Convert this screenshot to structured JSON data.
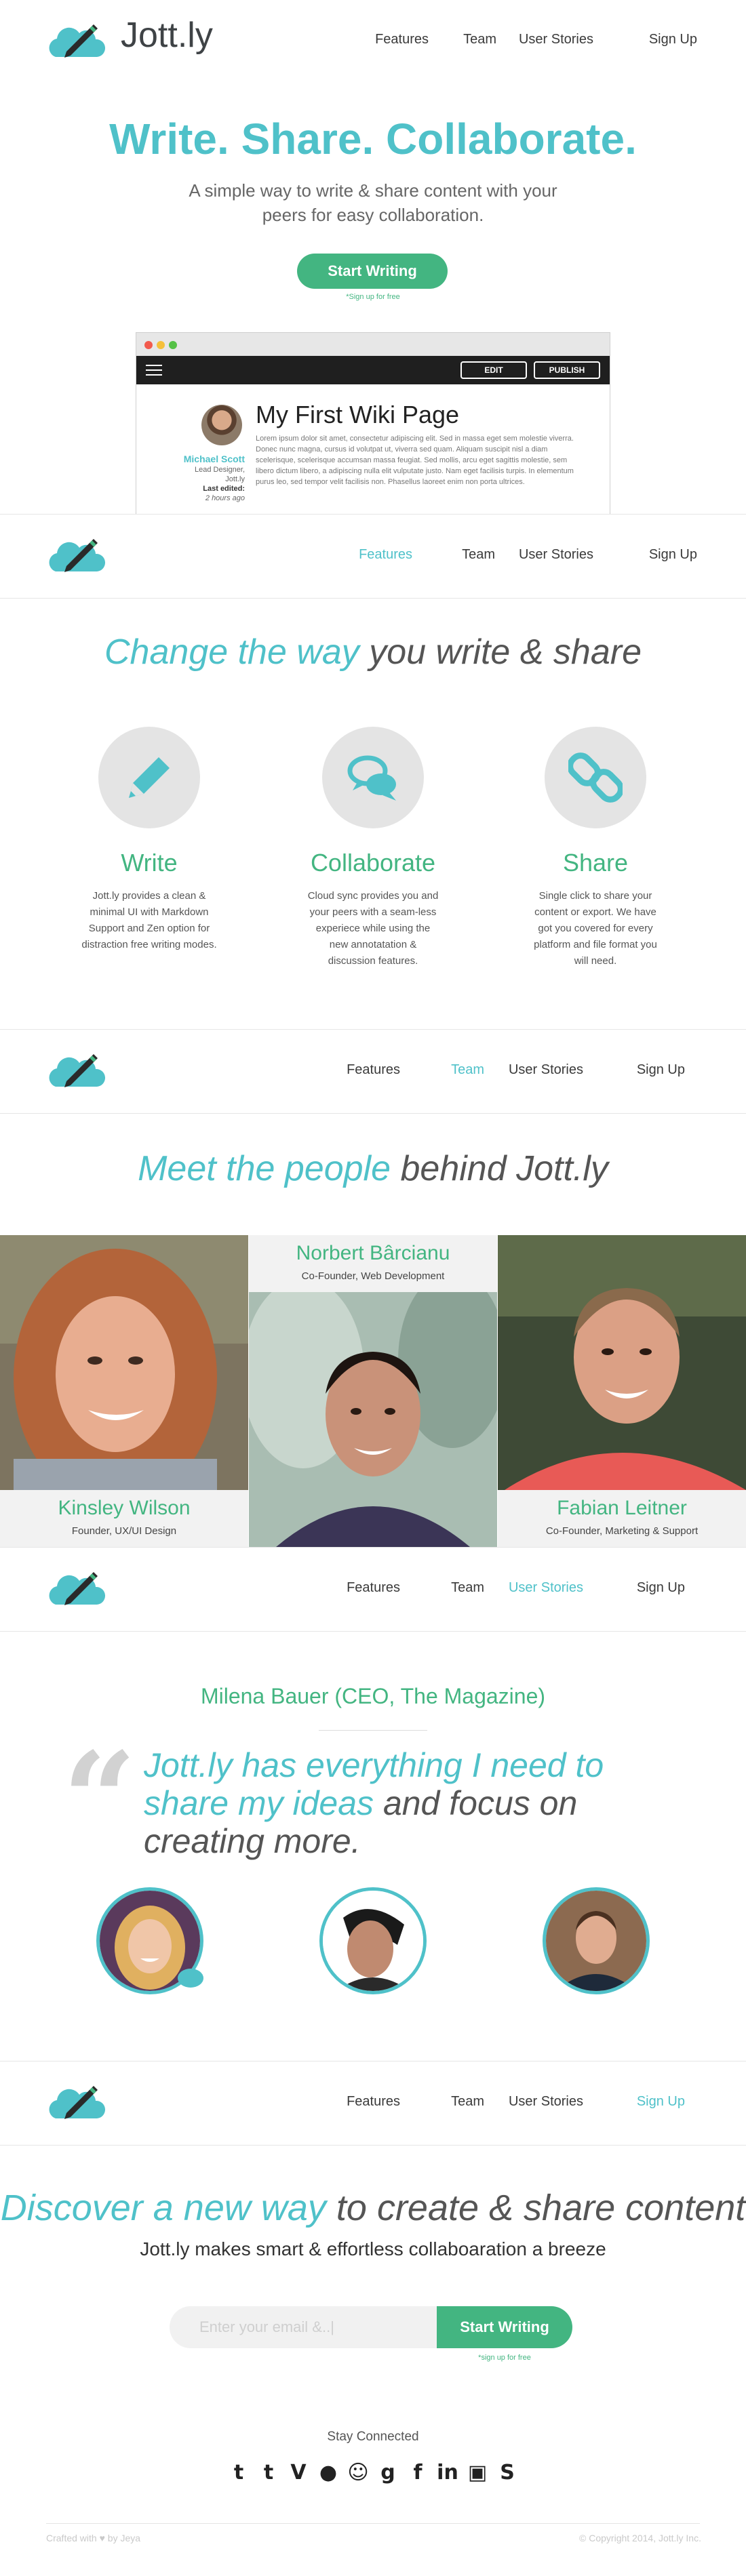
{
  "brand": {
    "name": "Jott.ly"
  },
  "nav": {
    "features": "Features",
    "team": "Team",
    "stories": "User Stories",
    "signup": "Sign Up"
  },
  "hero": {
    "title": "Write. Share. Collaborate.",
    "subtitle": "A simple way to write & share content with your peers for easy collaboration.",
    "cta": "Start Writing",
    "note": "*Sign up for free"
  },
  "mockup": {
    "edit": "EDIT",
    "publish": "PUBLISH",
    "author_name": "Michael Scott",
    "author_role": "Lead Designer,",
    "author_org": "Jott.ly",
    "last_edited_label": "Last edited:",
    "last_edited_value": "2 hours ago",
    "page_title": "My First Wiki Page",
    "body": "Lorem ipsum dolor sit amet, consectetur adipiscing elit. Sed in massa eget sem molestie viverra. Donec nunc magna, cursus id volutpat ut, viverra sed quam. Aliquam suscipit nisl a diam scelerisque, scelerisque accumsan massa feugiat. Sed mollis, arcu eget sagittis molestie, sem libero dictum libero, a adipiscing nulla elit vulputate justo. Nam eget facilisis turpis. In elementum purus leo, sed tempor velit facilisis non. Phasellus laoreet enim non porta ultrices."
  },
  "features_section": {
    "heading_accent": "Change the way",
    "heading_rest": " you write & share",
    "items": [
      {
        "icon": "pencil-icon",
        "title": "Write",
        "desc": "Jott.ly provides a clean & minimal UI with Markdown Support and Zen option for distraction free writing modes."
      },
      {
        "icon": "chat-bubbles-icon",
        "title": "Collaborate",
        "desc": "Cloud sync provides you and your peers with a seam-less experiece while using the new annotatation & discussion features."
      },
      {
        "icon": "link-icon",
        "title": "Share",
        "desc": "Single click to share your content or export. We have got you covered for every platform and file format you will need."
      }
    ]
  },
  "team_section": {
    "heading_accent": "Meet the people",
    "heading_rest": " behind Jott.ly",
    "members": [
      {
        "name": "Kinsley Wilson",
        "role": "Founder, UX/UI Design"
      },
      {
        "name": "Norbert Bârcianu",
        "role": "Co-Founder, Web Development"
      },
      {
        "name": "Fabian Leitner",
        "role": "Co-Founder, Marketing & Support"
      }
    ]
  },
  "stories_section": {
    "name": "Milena Bauer (CEO, The Magazine)",
    "quote_accent": "Jott.ly has everything I need to share my ideas",
    "quote_rest": " and focus on creating more."
  },
  "signup_section": {
    "heading_accent": "Discover a new way",
    "heading_rest": " to create & share content",
    "subheading": "Jott.ly makes smart & effortless collaboaration a breeze",
    "email_placeholder": "Enter your email &..|",
    "cta": "Start Writing",
    "note": "*sign up for free"
  },
  "footer": {
    "stay_connected": "Stay Connected",
    "social": [
      "twitter-icon",
      "tumblr-icon",
      "vine-icon",
      "flickr-icon",
      "github-icon",
      "google-plus-icon",
      "facebook-icon",
      "linkedin-icon",
      "instagram-icon",
      "skype-icon"
    ],
    "crafted_prefix": "Crafted with",
    "crafted_suffix": "by Jeya",
    "copyright": "© Copyright 2014, Jott.ly Inc."
  },
  "colors": {
    "teal": "#4fc1c9",
    "green": "#43b581",
    "dark": "#1f1f1f"
  }
}
